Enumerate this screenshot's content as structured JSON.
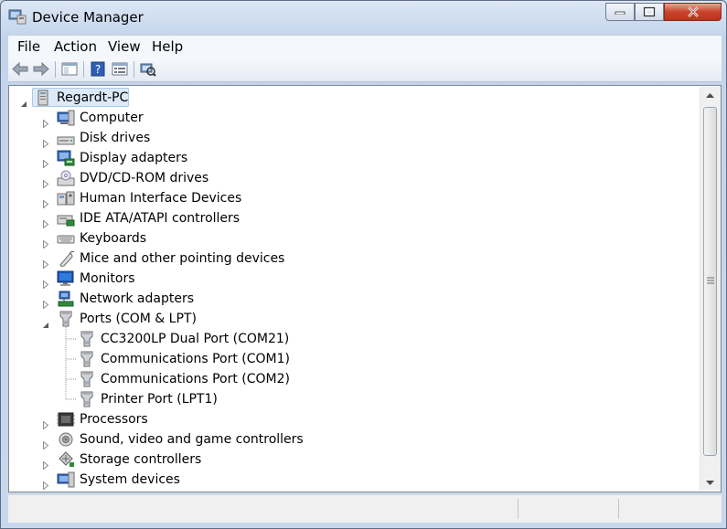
{
  "window": {
    "title": "Device Manager"
  },
  "menu": [
    "File",
    "Action",
    "View",
    "Help"
  ],
  "toolbar": {
    "buttons": [
      "back-icon",
      "forward-icon",
      "show-hide-console-tree-icon",
      "help-icon",
      "properties-icon",
      "scan-hardware-icon"
    ]
  },
  "tree": {
    "root": "Regardt-PC",
    "items": [
      {
        "label": "Computer",
        "icon": "computer-icon"
      },
      {
        "label": "Disk drives",
        "icon": "disk-drive-icon"
      },
      {
        "label": "Display adapters",
        "icon": "display-adapter-icon"
      },
      {
        "label": "DVD/CD-ROM drives",
        "icon": "dvd-drive-icon"
      },
      {
        "label": "Human Interface Devices",
        "icon": "hid-icon"
      },
      {
        "label": "IDE ATA/ATAPI controllers",
        "icon": "ide-controller-icon"
      },
      {
        "label": "Keyboards",
        "icon": "keyboard-icon"
      },
      {
        "label": "Mice and other pointing devices",
        "icon": "mouse-icon"
      },
      {
        "label": "Monitors",
        "icon": "monitor-icon"
      },
      {
        "label": "Network adapters",
        "icon": "network-adapter-icon"
      },
      {
        "label": "Ports (COM & LPT)",
        "icon": "port-icon",
        "expanded": true,
        "children": [
          "CC3200LP Dual Port (COM21)",
          "Communications Port (COM1)",
          "Communications Port (COM2)",
          "Printer Port (LPT1)"
        ]
      },
      {
        "label": "Processors",
        "icon": "processor-icon"
      },
      {
        "label": "Sound, video and game controllers",
        "icon": "sound-icon"
      },
      {
        "label": "Storage controllers",
        "icon": "storage-controller-icon"
      },
      {
        "label": "System devices",
        "icon": "system-devices-icon"
      }
    ]
  },
  "colors": {
    "selection": "#dceaf8",
    "close": "#c9452c"
  }
}
